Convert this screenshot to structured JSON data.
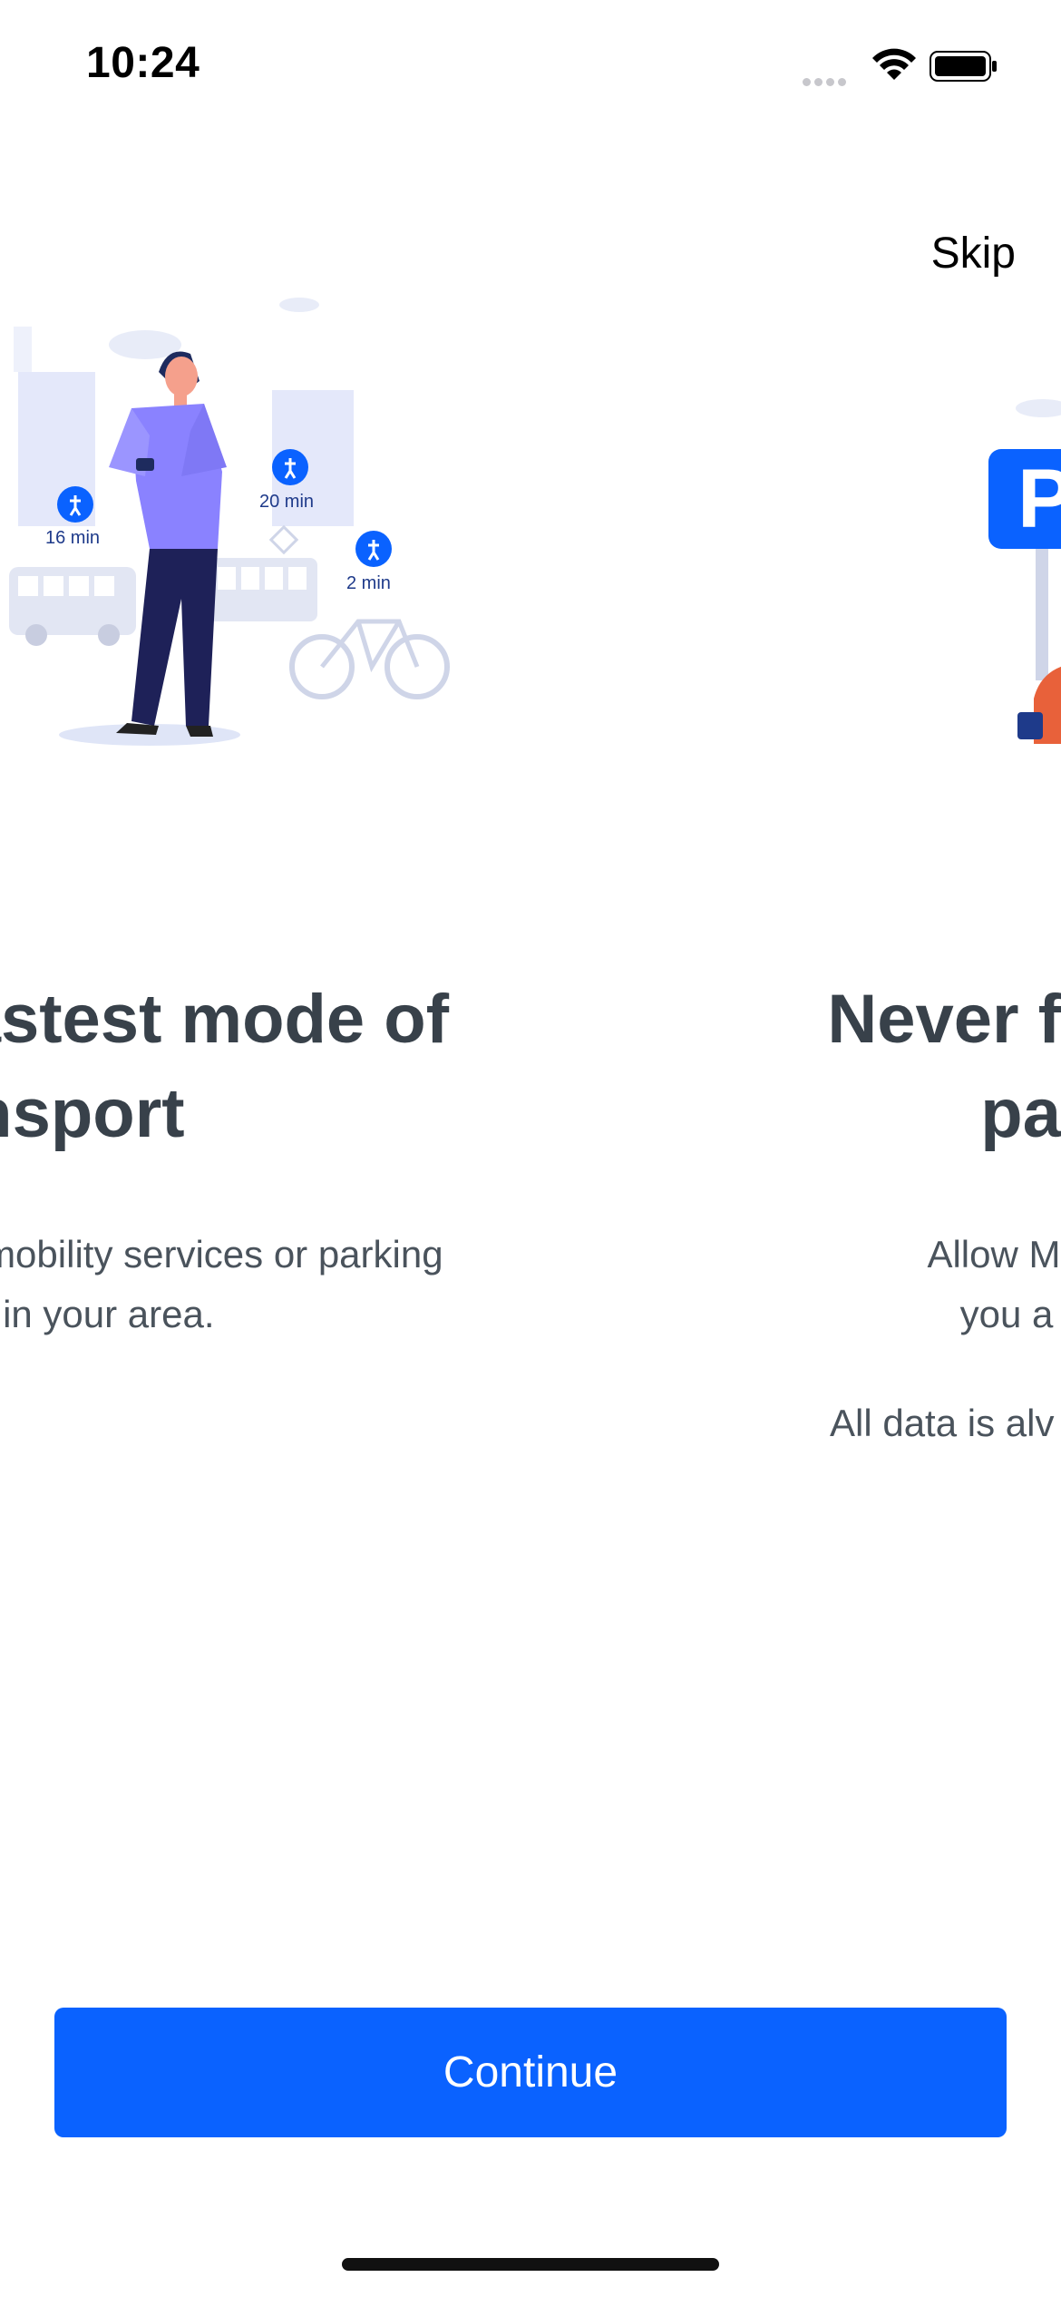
{
  "status_bar": {
    "time": "10:24",
    "icons": [
      "signal-icon",
      "wifi-icon",
      "battery-icon"
    ]
  },
  "header": {
    "skip_label": "Skip"
  },
  "slides": [
    {
      "title": "e fastest mode of\ntransport",
      "text": "nd all mobility services or parking\nplaces in your area.",
      "badges": [
        {
          "icon": "walk-icon",
          "label": "16 min"
        },
        {
          "icon": "walk-icon",
          "label": "20 min"
        },
        {
          "icon": "walk-icon",
          "label": "2 min"
        }
      ]
    },
    {
      "title": "Never f\npa",
      "text": "Allow Motion & F\nyou a remind",
      "note": "All data is alv",
      "sign_letter": "P"
    }
  ],
  "footer": {
    "continue_label": "Continue"
  },
  "colors": {
    "accent": "#0a62ff",
    "title": "#38414a",
    "body": "#4a535c"
  }
}
